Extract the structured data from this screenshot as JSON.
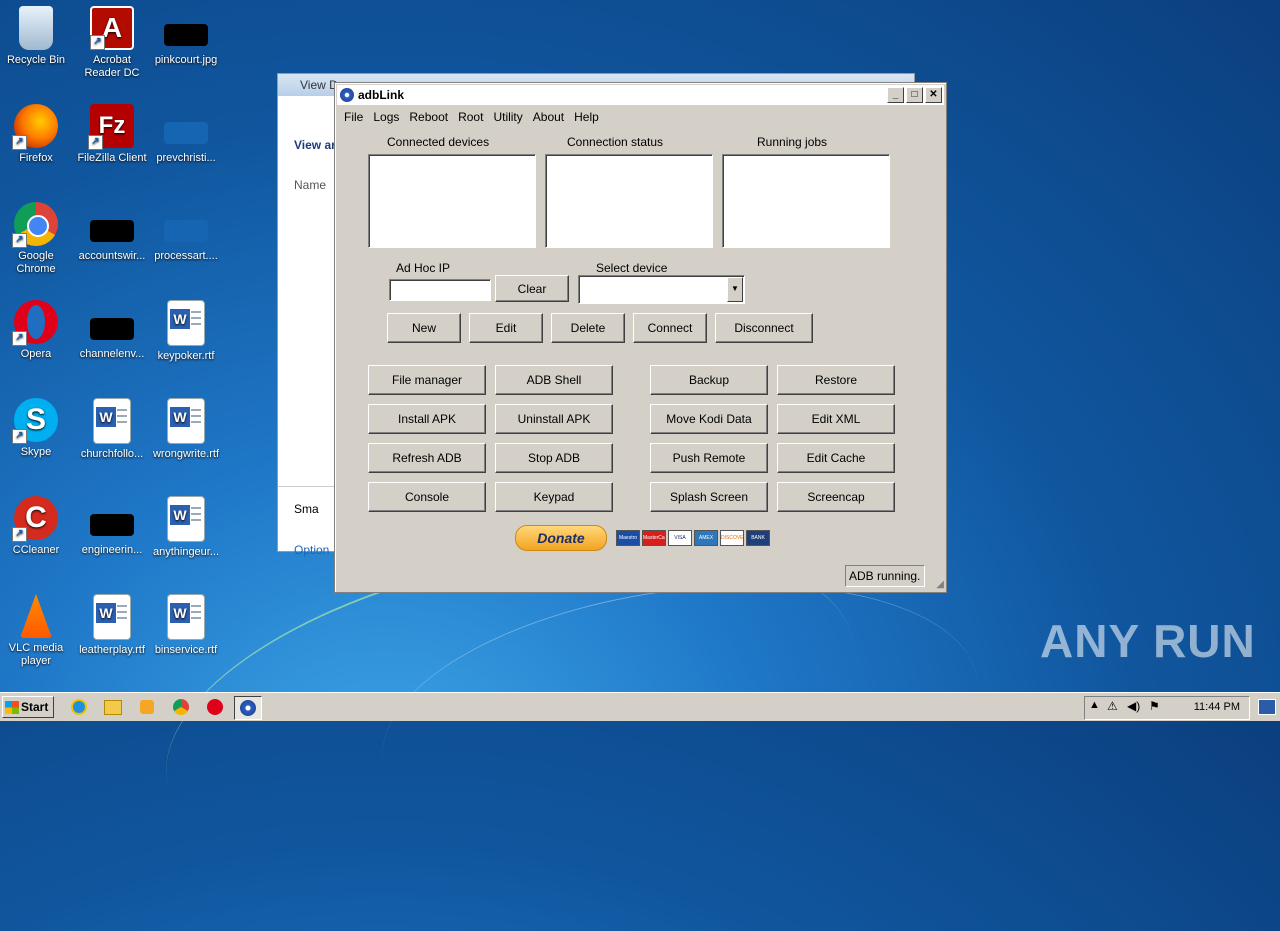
{
  "desktop": {
    "icons": [
      {
        "label": "Recycle Bin"
      },
      {
        "label": "Acrobat Reader DC"
      },
      {
        "label": "pinkcourt.jpg"
      },
      {
        "label": "Firefox"
      },
      {
        "label": "FileZilla Client"
      },
      {
        "label": "prevchristi..."
      },
      {
        "label": "Google Chrome"
      },
      {
        "label": "accountswir..."
      },
      {
        "label": "processart...."
      },
      {
        "label": "Opera"
      },
      {
        "label": "channelenv..."
      },
      {
        "label": "keypoker.rtf"
      },
      {
        "label": "Skype"
      },
      {
        "label": "churchfollo..."
      },
      {
        "label": "wrongwrite.rtf"
      },
      {
        "label": "CCleaner"
      },
      {
        "label": "engineerin..."
      },
      {
        "label": "anythingeur..."
      },
      {
        "label": "VLC media player"
      },
      {
        "label": "leatherplay.rtf"
      },
      {
        "label": "binservice.rtf"
      }
    ],
    "watermark": "ANY RUN"
  },
  "background_window": {
    "title": "View D",
    "heading": "View ar",
    "column": "Name",
    "footer_item": "Sma",
    "options": "Option"
  },
  "adblink": {
    "title": "adbLink",
    "menu": [
      "File",
      "Logs",
      "Reboot",
      "Root",
      "Utility",
      "About",
      "Help"
    ],
    "sections": {
      "connected": "Connected devices",
      "status": "Connection status",
      "jobs": "Running jobs"
    },
    "adhoc_label": "Ad Hoc IP",
    "adhoc_value": "",
    "clear": "Clear",
    "select_label": "Select device",
    "select_value": "",
    "device_buttons": [
      "New",
      "Edit",
      "Delete",
      "Connect",
      "Disconnect"
    ],
    "left_buttons": [
      "File manager",
      "ADB Shell",
      "Install APK",
      "Uninstall APK",
      "Refresh ADB",
      "Stop ADB",
      "Console",
      "Keypad"
    ],
    "right_buttons": [
      "Backup",
      "Restore",
      "Move Kodi Data",
      "Edit XML",
      "Push Remote",
      "Edit Cache",
      "Splash Screen",
      "Screencap"
    ],
    "donate": "Donate",
    "cards": [
      "Maestro",
      "MasterCard",
      "VISA",
      "AMEX",
      "DISCOVER",
      "BANK"
    ],
    "status": "ADB running."
  },
  "taskbar": {
    "start": "Start",
    "clock": "11:44 PM"
  }
}
